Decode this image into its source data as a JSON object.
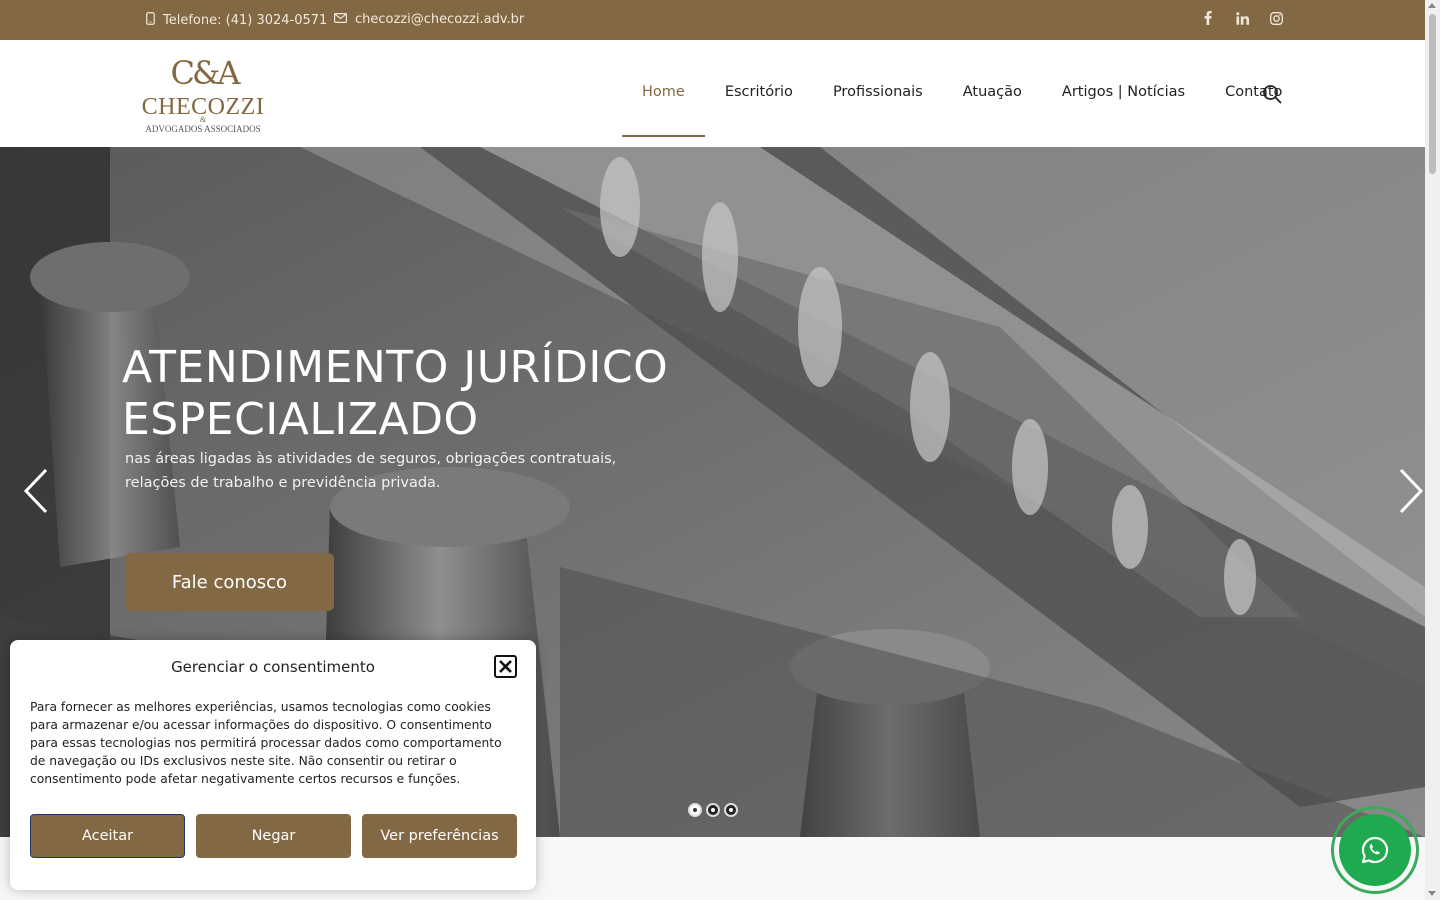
{
  "topbar": {
    "phone": "Telefone: (41) 3024-0571",
    "email": "checozzi@checozzi.adv.br",
    "social_icons": [
      "facebook-icon",
      "linkedin-icon",
      "instagram-icon"
    ]
  },
  "logo": {
    "monogram": "C&A",
    "name": "CHECOZZI",
    "amp": "&",
    "tagline": "ADVOGADOS ASSOCIADOS"
  },
  "nav": {
    "items": [
      {
        "label": "Home",
        "active": true
      },
      {
        "label": "Escritório"
      },
      {
        "label": "Profissionais"
      },
      {
        "label": "Atuação"
      },
      {
        "label": "Artigos | Notícias"
      },
      {
        "label": "Contato"
      }
    ],
    "search_icon": "search-icon"
  },
  "hero": {
    "title_line1": "ATENDIMENTO JURÍDICO",
    "title_line2": "ESPECIALIZADO",
    "subtitle": "nas áreas ligadas às atividades de seguros, obrigações contratuais, relações de trabalho e previdência privada.",
    "cta": "Fale conosco",
    "slides": 3,
    "active_slide": 1
  },
  "consent": {
    "title": "Gerenciar o consentimento",
    "text": "Para fornecer as melhores experiências, usamos tecnologias como cookies para armazenar e/ou acessar informações do dispositivo. O consentimento para essas tecnologias nos permitirá processar dados como comportamento de navegação ou IDs exclusivos neste site. Não consentir ou retirar o consentimento pode afetar negativamente certos recursos e funções.",
    "accept": "Aceitar",
    "deny": "Negar",
    "preferences": "Ver preferências"
  },
  "colors": {
    "brand": "#836844",
    "whatsapp": "#1faa4f"
  }
}
